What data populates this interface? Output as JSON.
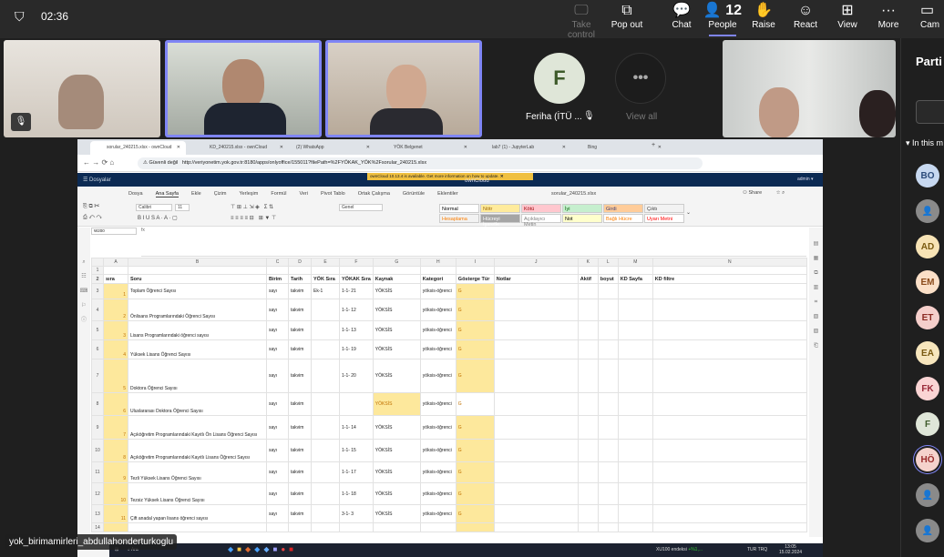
{
  "meeting": {
    "time": "02:36",
    "people_count": "12",
    "toolbar": [
      {
        "label": "Take control",
        "icon": "screen-control-icon",
        "disabled": true
      },
      {
        "label": "Pop out",
        "icon": "pop-out-icon"
      },
      {
        "label": "Chat",
        "icon": "chat-icon"
      },
      {
        "label": "People",
        "icon": "people-icon"
      },
      {
        "label": "Raise",
        "icon": "hand-icon"
      },
      {
        "label": "React",
        "icon": "smiley-icon"
      },
      {
        "label": "View",
        "icon": "grid-icon"
      },
      {
        "label": "More",
        "icon": "more-icon"
      },
      {
        "label": "Cam",
        "icon": "camera-icon"
      }
    ],
    "feriha_initial": "F",
    "feriha_name": "Feriha (İTÜ ...",
    "view_all": "View all",
    "presenter_label": "yok_birimamirleri_abdullahonderturkoglu"
  },
  "participants_panel": {
    "title": "Parti",
    "section": "In this m",
    "avatars": [
      {
        "i": "BO",
        "bg": "#c7d8f0",
        "fg": "#2b4a7a"
      },
      {
        "i": "",
        "bg": "#8a8a8a",
        "fg": "#fff"
      },
      {
        "i": "AD",
        "bg": "#f7e3b5",
        "fg": "#7a5a10"
      },
      {
        "i": "EM",
        "bg": "#fbe0c8",
        "fg": "#8a4a1a"
      },
      {
        "i": "ET",
        "bg": "#f5cfcb",
        "fg": "#8a2a22"
      },
      {
        "i": "EA",
        "bg": "#f7e6bd",
        "fg": "#7a5a10"
      },
      {
        "i": "FK",
        "bg": "#fad4d4",
        "fg": "#9a2a3a"
      },
      {
        "i": "F",
        "bg": "#dfe6d8",
        "fg": "#3d5a2a"
      },
      {
        "i": "HÖ",
        "bg": "#f5d2cc",
        "fg": "#9a2a2a"
      },
      {
        "i": "",
        "bg": "#8a8a8a",
        "fg": "#fff"
      },
      {
        "i": "",
        "bg": "#8a8a8a",
        "fg": "#fff"
      }
    ]
  },
  "browser": {
    "tabs": [
      "sorular_240215.xlsx - ownCloud",
      "KD_240215.xlsx - ownCloud",
      "(2) WhatsApp",
      "YÖK Belgenet",
      "lab7 (1) - JupyterLab",
      "Bing"
    ],
    "security": "Güvenli değil",
    "url": "http://veriyonetim.yok.gov.tr:8180/apps/onlyoffice/155011?filePath=%2FYÖKAK_YÖK%2Fsorular_240215.xlsx"
  },
  "owncloud": {
    "menu": "Dosyalar",
    "notice": "ownCloud 10.13.4 is available. Get more information on how to update.",
    "brand": "ownCloud",
    "user": "admin"
  },
  "editor": {
    "filename": "sorular_240215.xlsx",
    "share": "Share",
    "tabs": [
      "Dosya",
      "Ana Sayfa",
      "Ekle",
      "Çizim",
      "Yerleşim",
      "Formül",
      "Veri",
      "Pivot Tablo",
      "Ortak Çalışma",
      "Görüntüle",
      "Eklentiler"
    ],
    "font": "Calibri",
    "size": "11",
    "format": "Genel",
    "cell_ref": "W200",
    "styles": [
      {
        "t": "Normal",
        "bg": "#fff",
        "c": "#000"
      },
      {
        "t": "Nötr",
        "bg": "#ffeb9c",
        "c": "#9c6500"
      },
      {
        "t": "Kötü",
        "bg": "#ffc7ce",
        "c": "#9c0006"
      },
      {
        "t": "İyi",
        "bg": "#c6efce",
        "c": "#006100"
      },
      {
        "t": "Girdi",
        "bg": "#ffcc99",
        "c": "#3f3f76"
      },
      {
        "t": "Çıktı",
        "bg": "#f2f2f2",
        "c": "#3f3f3f"
      },
      {
        "t": "Hesaplama",
        "bg": "#f2f2f2",
        "c": "#fa7d00"
      },
      {
        "t": "Hücreyi İşaretle",
        "bg": "#a5a5a5",
        "c": "#fff"
      },
      {
        "t": "Açıklayıcı Metin",
        "bg": "#fff",
        "c": "#7f7f7f"
      },
      {
        "t": "Not",
        "bg": "#ffffcc",
        "c": "#000"
      },
      {
        "t": "Bağlı Hücre",
        "bg": "#fff",
        "c": "#fa7d00"
      },
      {
        "t": "Uyarı Metni",
        "bg": "#fff",
        "c": "#ff0000"
      }
    ],
    "zoom": "Yakınlaştırma 100%"
  },
  "sheet": {
    "columns": [
      "A",
      "B",
      "C",
      "D",
      "E",
      "F",
      "G",
      "H",
      "I",
      "J",
      "K",
      "L",
      "M",
      "N"
    ],
    "headers": [
      "sıra",
      "Soru",
      "Birim",
      "Tarih",
      "YÖK Sıra",
      "YÖKAK Sıra",
      "Kaynak",
      "Kategori",
      "Gösterge Tür",
      "Notlar",
      "Aktif",
      "boyut",
      "KD Sayfa",
      "KD filtre"
    ],
    "rows": [
      [
        "1",
        "Toplam Öğrenci Sayısı",
        "sayı",
        "takvim",
        "Ek-1",
        "1-1- 21",
        "YÖKSİS",
        "yöksis-öğrenci",
        "G"
      ],
      [
        "2",
        "Önlisans Programlarındaki Öğrenci Sayısı",
        "sayı",
        "takvim",
        "",
        "1-1- 12",
        "YÖKSİS",
        "yöksis-öğrenci",
        "G"
      ],
      [
        "3",
        "Lisans Programlarındaki öğrenci sayısı",
        "sayı",
        "takvim",
        "",
        "1-1- 13",
        "YÖKSİS",
        "yöksis-öğrenci",
        "G"
      ],
      [
        "4",
        "Yüksek Lisans Öğrenci Sayısı",
        "sayı",
        "takvim",
        "",
        "1-1- 19",
        "YÖKSİS",
        "yöksis-öğrenci",
        "G"
      ],
      [
        "5",
        "Doktora Öğrenci Sayısı",
        "sayı",
        "takvim",
        "",
        "1-1- 20",
        "YÖKSİS",
        "yöksis-öğrenci",
        "G"
      ],
      [
        "6",
        "Uluslararası Doktora Öğrenci Sayısı",
        "sayı",
        "takvim",
        "",
        "",
        "YÖKSİS",
        "yöksis-öğrenci",
        "G"
      ],
      [
        "7",
        "Açıköğretim Programlarındaki Kayıtlı Ön Lisans Öğrenci Sayısı",
        "sayı",
        "takvim",
        "",
        "1-1- 14",
        "YÖKSİS",
        "yöksis-öğrenci",
        "G"
      ],
      [
        "8",
        "Açıköğretim Programlarındaki Kayıtlı Lisans Öğrenci Sayısı",
        "sayı",
        "takvim",
        "",
        "1-1- 15",
        "YÖKSİS",
        "yöksis-öğrenci",
        "G"
      ],
      [
        "9",
        "Tezli Yüksek Lisans Öğrenci Sayısı",
        "sayı",
        "takvim",
        "",
        "1-1- 17",
        "YÖKSİS",
        "yöksis-öğrenci",
        "G"
      ],
      [
        "10",
        "Tezsiz Yüksek Lisans Öğrenci Sayısı",
        "sayı",
        "takvim",
        "",
        "1-1- 18",
        "YÖKSİS",
        "yöksis-öğrenci",
        "G"
      ],
      [
        "11",
        "Çift anadal yapan lisans öğrenci sayısı",
        "sayı",
        "takvim",
        "",
        "3-1- 3",
        "YÖKSİS",
        "yöksis-öğrenci",
        "G"
      ]
    ]
  },
  "taskbar": {
    "search": "Ara",
    "stock": "XU100 endeksi",
    "stock_change": "+%1,...",
    "lang": "TUR TRQ",
    "clock": "13:05",
    "date": "15.02.2024"
  }
}
